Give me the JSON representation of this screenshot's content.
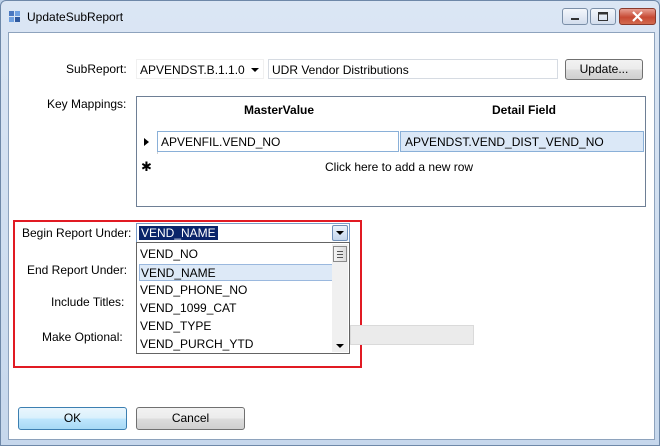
{
  "window": {
    "title": "UpdateSubReport",
    "icon": "window-app-icon"
  },
  "subreport": {
    "label": "SubReport:",
    "code": "APVENDST.B.1.1.0",
    "description": "UDR Vendor Distributions",
    "update_label": "Update..."
  },
  "key_mappings": {
    "label": "Key Mappings:",
    "columns": [
      "MasterValue",
      "Detail Field"
    ],
    "rows": [
      {
        "master": "APVENFIL.VEND_NO",
        "detail": "APVENDST.VEND_DIST_VEND_NO"
      }
    ],
    "new_row_text": "Click here to add a new row"
  },
  "fields": {
    "begin_label": "Begin Report Under:",
    "end_label": "End Report Under:",
    "titles_label": "Include Titles:",
    "optional_label": "Make Optional:"
  },
  "dropdown": {
    "selected": "VEND_NAME",
    "options": [
      "VEND_NO",
      "VEND_NAME",
      "VEND_PHONE_NO",
      "VEND_1099_CAT",
      "VEND_TYPE",
      "VEND_PURCH_YTD"
    ]
  },
  "buttons": {
    "ok": "OK",
    "cancel": "Cancel"
  },
  "colors": {
    "highlight_border": "#e11a23",
    "selection": "#0a246a"
  }
}
